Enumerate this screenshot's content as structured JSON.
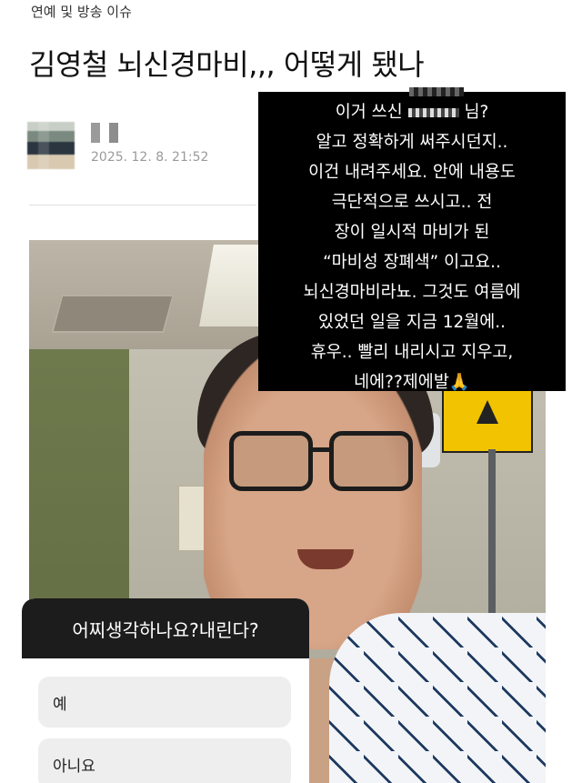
{
  "article": {
    "category": "연예 및 방송 이슈",
    "title": "김영철 뇌신경마비,,, 어떻게 됐나",
    "author": "■ ■",
    "date": "2025. 12. 8. 21:52"
  },
  "story_overlay": {
    "lines": [
      "이거 쓰신",
      "님?",
      "알고 정확하게 써주시던지..",
      "이건 내려주세요. 안에 내용도",
      "극단적으로 쓰시고.. 전",
      "장이 일시적 마비가 된",
      "“마비성 장폐색” 이고요..",
      "뇌신경마비라뇨. 그것도 여름에",
      "있었던 일을 지금 12월에..",
      "휴우.. 빨리 내리시고 지우고,",
      "네에??제에발🙏"
    ]
  },
  "poll": {
    "question": "어찌생각하나요?내린다?",
    "options": [
      "예",
      "아니요"
    ]
  }
}
